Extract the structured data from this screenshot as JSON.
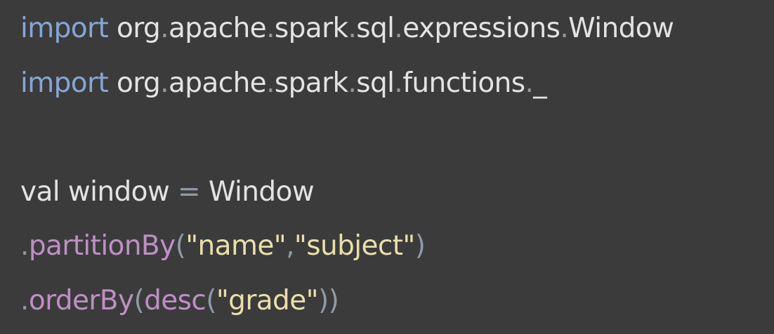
{
  "editor": {
    "lines": [
      {
        "id": "line-1",
        "tokens": [
          {
            "name": "keyword-import",
            "kind": "keyword",
            "text": "import"
          },
          {
            "name": "space",
            "kind": "plain",
            "text": " "
          },
          {
            "name": "package-org",
            "kind": "plain",
            "text": "org"
          },
          {
            "name": "dot",
            "kind": "punct",
            "text": "."
          },
          {
            "name": "package-apache",
            "kind": "plain",
            "text": "apache"
          },
          {
            "name": "dot",
            "kind": "punct",
            "text": "."
          },
          {
            "name": "package-spark",
            "kind": "plain",
            "text": "spark"
          },
          {
            "name": "dot",
            "kind": "punct",
            "text": "."
          },
          {
            "name": "package-sql",
            "kind": "plain",
            "text": "sql"
          },
          {
            "name": "dot",
            "kind": "punct",
            "text": "."
          },
          {
            "name": "package-expressions",
            "kind": "plain",
            "text": "expressions"
          },
          {
            "name": "dot",
            "kind": "punct",
            "text": "."
          },
          {
            "name": "class-window",
            "kind": "plain",
            "text": "Window"
          }
        ]
      },
      {
        "id": "line-2",
        "tokens": [
          {
            "name": "keyword-import",
            "kind": "keyword",
            "text": "import"
          },
          {
            "name": "space",
            "kind": "plain",
            "text": " "
          },
          {
            "name": "package-org",
            "kind": "plain",
            "text": "org"
          },
          {
            "name": "dot",
            "kind": "punct",
            "text": "."
          },
          {
            "name": "package-apache",
            "kind": "plain",
            "text": "apache"
          },
          {
            "name": "dot",
            "kind": "punct",
            "text": "."
          },
          {
            "name": "package-spark",
            "kind": "plain",
            "text": "spark"
          },
          {
            "name": "dot",
            "kind": "punct",
            "text": "."
          },
          {
            "name": "package-sql",
            "kind": "plain",
            "text": "sql"
          },
          {
            "name": "dot",
            "kind": "punct",
            "text": "."
          },
          {
            "name": "package-functions",
            "kind": "plain",
            "text": "functions"
          },
          {
            "name": "dot",
            "kind": "punct",
            "text": "."
          },
          {
            "name": "wildcard",
            "kind": "plain",
            "text": "_"
          }
        ]
      },
      {
        "id": "line-3",
        "tokens": []
      },
      {
        "id": "line-4",
        "tokens": [
          {
            "name": "keyword-val",
            "kind": "plain",
            "text": "val"
          },
          {
            "name": "space",
            "kind": "plain",
            "text": " "
          },
          {
            "name": "variable-window",
            "kind": "plain",
            "text": "window"
          },
          {
            "name": "space",
            "kind": "plain",
            "text": " "
          },
          {
            "name": "equals",
            "kind": "punct",
            "text": "="
          },
          {
            "name": "space",
            "kind": "plain",
            "text": " "
          },
          {
            "name": "class-window",
            "kind": "plain",
            "text": "Window"
          }
        ]
      },
      {
        "id": "line-5",
        "tokens": [
          {
            "name": "dot",
            "kind": "punct",
            "text": "."
          },
          {
            "name": "method-partitionby",
            "kind": "method",
            "text": "partitionBy"
          },
          {
            "name": "paren-open",
            "kind": "punct",
            "text": "("
          },
          {
            "name": "string-name",
            "kind": "string",
            "text": "\"name\""
          },
          {
            "name": "comma",
            "kind": "punct",
            "text": ","
          },
          {
            "name": "string-subject",
            "kind": "string",
            "text": "\"subject\""
          },
          {
            "name": "paren-close",
            "kind": "punct",
            "text": ")"
          }
        ]
      },
      {
        "id": "line-6",
        "tokens": [
          {
            "name": "dot",
            "kind": "punct",
            "text": "."
          },
          {
            "name": "method-orderby",
            "kind": "method",
            "text": "orderBy"
          },
          {
            "name": "paren-open",
            "kind": "punct",
            "text": "("
          },
          {
            "name": "method-desc",
            "kind": "method",
            "text": "desc"
          },
          {
            "name": "paren-open",
            "kind": "punct",
            "text": "("
          },
          {
            "name": "string-grade",
            "kind": "string",
            "text": "\"grade\""
          },
          {
            "name": "paren-close",
            "kind": "punct",
            "text": "))"
          }
        ]
      }
    ]
  },
  "colors": {
    "background": "#3b3b3c",
    "keyword": "#86a6d4",
    "plain": "#e3e3e3",
    "punct": "#8e9aa5",
    "method": "#bf8fc4",
    "string": "#eadfaa"
  }
}
